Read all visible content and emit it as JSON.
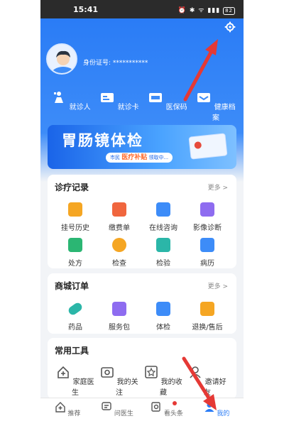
{
  "status_bar": {
    "time": "15:41",
    "indicators": "⏰ ✱ ᯤ ▮▮▮",
    "battery": "82"
  },
  "profile": {
    "id_label": "身份证号: ***********"
  },
  "quick_actions": [
    {
      "label": "就诊人",
      "icon": "patient-icon"
    },
    {
      "label": "就诊卡",
      "icon": "card-icon"
    },
    {
      "label": "医保码",
      "icon": "insurance-code-icon"
    },
    {
      "label": "健康档案",
      "icon": "health-record-icon"
    }
  ],
  "banner": {
    "title": "胃肠镜体检",
    "tag_prefix": "市民",
    "tag_highlight": "医疗补贴",
    "tag_suffix": "领取中..."
  },
  "sections": {
    "records": {
      "title": "诊疗记录",
      "more": "更多 >",
      "items": [
        {
          "label": "挂号历史",
          "color": "#f5a623"
        },
        {
          "label": "缴费单",
          "color": "#f0663e"
        },
        {
          "label": "在线咨询",
          "color": "#3d8cf8"
        },
        {
          "label": "影像诊断",
          "color": "#8e6cf0"
        },
        {
          "label": "处方",
          "color": "#2bb673"
        },
        {
          "label": "检查",
          "color": "#f5a623"
        },
        {
          "label": "检验",
          "color": "#2bb6a8"
        },
        {
          "label": "病历",
          "color": "#3d8cf8"
        }
      ]
    },
    "mall": {
      "title": "商城订单",
      "more": "更多 >",
      "items": [
        {
          "label": "药品",
          "color": "#2bb6a8"
        },
        {
          "label": "服务包",
          "color": "#8e6cf0"
        },
        {
          "label": "体检",
          "color": "#3d8cf8"
        },
        {
          "label": "退换/售后",
          "color": "#f5a623"
        }
      ]
    },
    "tools": {
      "title": "常用工具",
      "items": [
        {
          "label": "家庭医生"
        },
        {
          "label": "我的关注"
        },
        {
          "label": "我的收藏"
        },
        {
          "label": "邀请好友"
        }
      ]
    }
  },
  "tabs": [
    {
      "label": "推荐",
      "icon": "home-icon"
    },
    {
      "label": "问医生",
      "icon": "chat-icon"
    },
    {
      "label": "看头条",
      "icon": "news-icon"
    },
    {
      "label": "我的",
      "icon": "user-icon"
    }
  ],
  "colors": {
    "primary": "#2a7cf6",
    "annotation_arrow": "#e53935"
  }
}
